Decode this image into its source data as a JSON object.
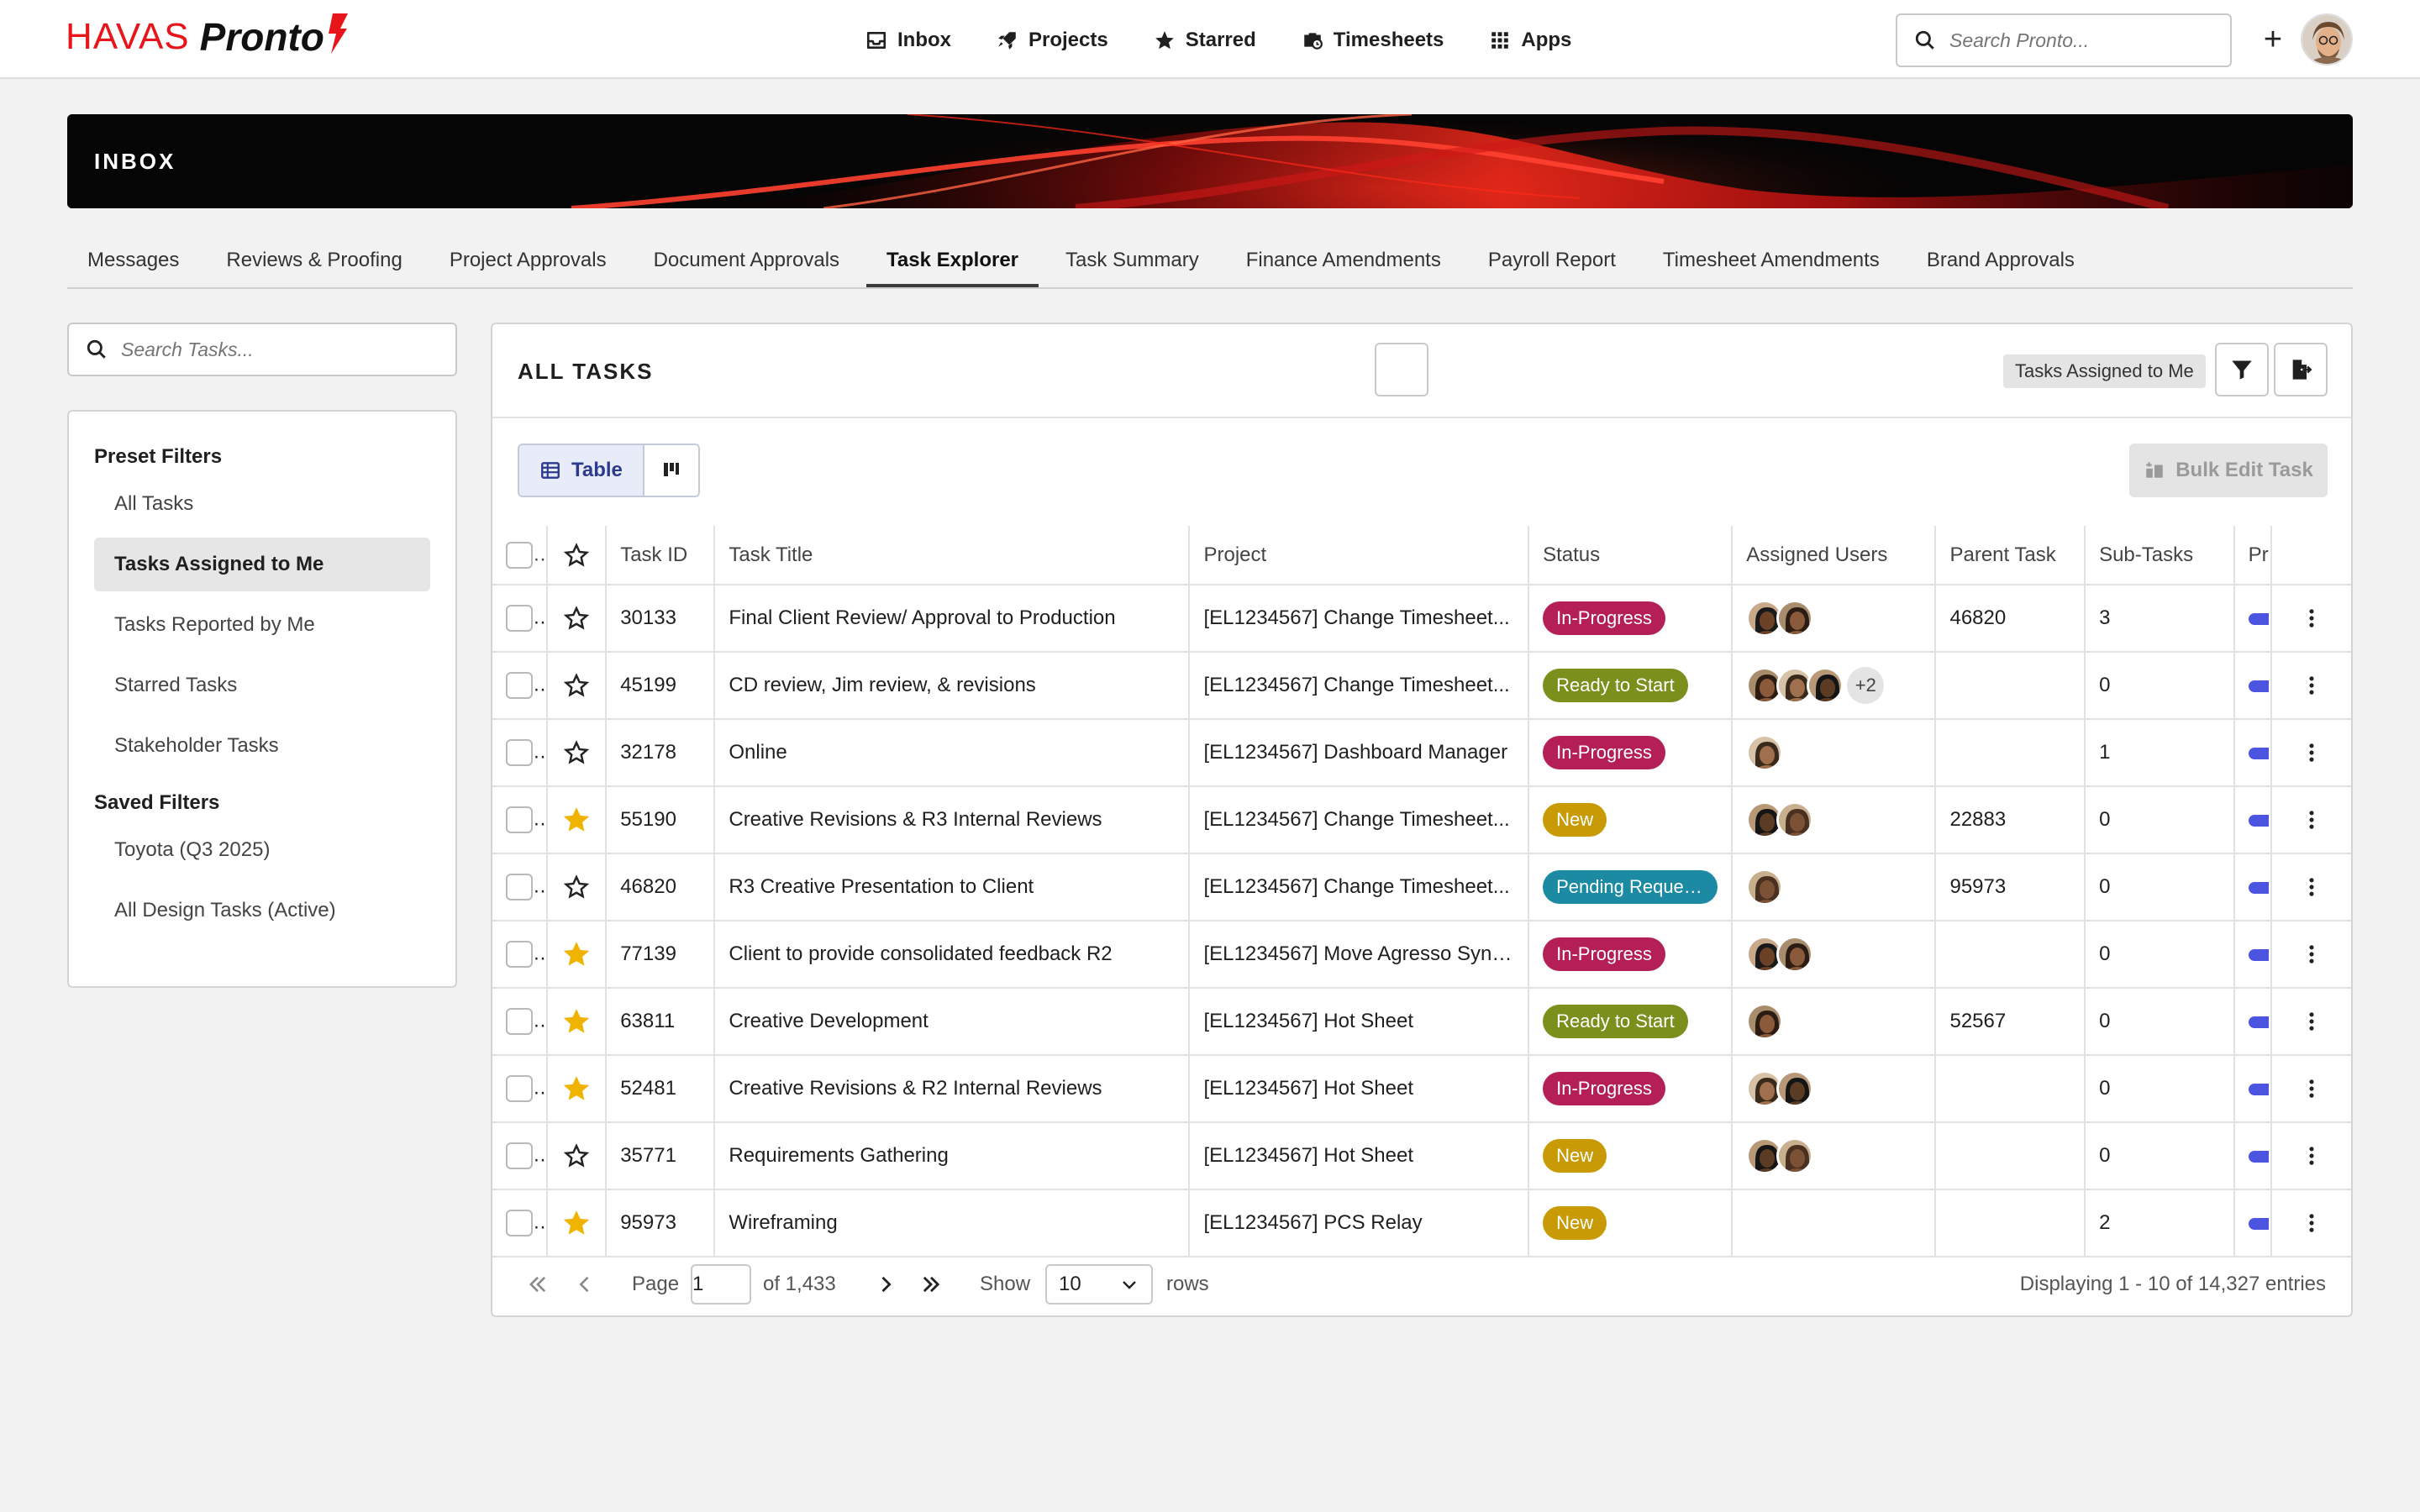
{
  "brand": {
    "havas": "HAVAS",
    "pronto": "Pronto"
  },
  "nav": [
    {
      "label": "Inbox",
      "icon": "inbox-icon"
    },
    {
      "label": "Projects",
      "icon": "rocket-icon"
    },
    {
      "label": "Starred",
      "icon": "star-icon"
    },
    {
      "label": "Timesheets",
      "icon": "briefcase-clock-icon"
    },
    {
      "label": "Apps",
      "icon": "grid-icon"
    }
  ],
  "search": {
    "placeholder": "Search Pronto..."
  },
  "banner": {
    "title": "INBOX"
  },
  "tabs": [
    "Messages",
    "Reviews & Proofing",
    "Project Approvals",
    "Document Approvals",
    "Task Explorer",
    "Task Summary",
    "Finance Amendments",
    "Payroll Report",
    "Timesheet Amendments",
    "Brand Approvals"
  ],
  "active_tab": "Task Explorer",
  "left": {
    "search_placeholder": "Search Tasks...",
    "preset_heading": "Preset Filters",
    "preset": [
      "All Tasks",
      "Tasks Assigned to Me",
      "Tasks Reported by Me",
      "Starred Tasks",
      "Stakeholder Tasks"
    ],
    "saved_heading": "Saved Filters",
    "saved": [
      "Toyota (Q3 2025)",
      "All Design Tasks (Active)"
    ]
  },
  "card": {
    "title": "ALL TASKS",
    "active_filter": "Tasks Assigned to Me",
    "view_table": "Table",
    "bulk_edit": "Bulk Edit Task"
  },
  "columns": [
    "Task ID",
    "Task Title",
    "Project",
    "Status",
    "Assigned Users",
    "Parent Task",
    "Sub-Tasks",
    "Pr"
  ],
  "status_colors": {
    "In-Progress": "#b51f57",
    "Ready to Start": "#7a8f1c",
    "New": "#c79a06",
    "Pending Reques...": "#1d8aa3"
  },
  "rows": [
    {
      "id": "30133",
      "title": "Final Client Review/ Approval to Production",
      "project": "[EL1234567] Change Timesheet...",
      "status": "In-Progress",
      "users": 2,
      "more": "",
      "parent": "46820",
      "subtasks": "3",
      "starred": false
    },
    {
      "id": "45199",
      "title": "CD review, Jim review, & revisions",
      "project": "[EL1234567] Change Timesheet...",
      "status": "Ready to Start",
      "users": 3,
      "more": "+2",
      "parent": "",
      "subtasks": "0",
      "starred": false
    },
    {
      "id": "32178",
      "title": "Online",
      "project": "[EL1234567] Dashboard Manager",
      "status": "In-Progress",
      "users": 1,
      "more": "",
      "parent": "",
      "subtasks": "1",
      "starred": false
    },
    {
      "id": "55190",
      "title": "Creative Revisions & R3 Internal Reviews",
      "project": "[EL1234567] Change Timesheet...",
      "status": "New",
      "users": 2,
      "more": "",
      "parent": "22883",
      "subtasks": "0",
      "starred": true
    },
    {
      "id": "46820",
      "title": "R3 Creative Presentation to Client",
      "project": "[EL1234567] Change Timesheet...",
      "status": "Pending Reques...",
      "users": 1,
      "more": "",
      "parent": "95973",
      "subtasks": "0",
      "starred": false
    },
    {
      "id": "77139",
      "title": "Client to provide consolidated feedback R2",
      "project": "[EL1234567] Move Agresso Sync...",
      "status": "In-Progress",
      "users": 2,
      "more": "",
      "parent": "",
      "subtasks": "0",
      "starred": true
    },
    {
      "id": "63811",
      "title": "Creative Development",
      "project": "[EL1234567] Hot Sheet",
      "status": "Ready to Start",
      "users": 1,
      "more": "",
      "parent": "52567",
      "subtasks": "0",
      "starred": true
    },
    {
      "id": "52481",
      "title": "Creative Revisions & R2 Internal Reviews",
      "project": "[EL1234567] Hot Sheet",
      "status": "In-Progress",
      "users": 2,
      "more": "",
      "parent": "",
      "subtasks": "0",
      "starred": true
    },
    {
      "id": "35771",
      "title": "Requirements Gathering",
      "project": "[EL1234567] Hot Sheet",
      "status": "New",
      "users": 2,
      "more": "",
      "parent": "",
      "subtasks": "0",
      "starred": false
    },
    {
      "id": "95973",
      "title": "Wireframing",
      "project": "[EL1234567] PCS Relay",
      "status": "New",
      "users": 0,
      "more": "",
      "parent": "",
      "subtasks": "2",
      "starred": true
    }
  ],
  "pager": {
    "page_label": "Page",
    "page": "1",
    "of": "of 1,433",
    "show": "Show",
    "rows_value": "10",
    "rows_label": "rows",
    "summary": "Displaying 1 - 10 of 14,327 entries"
  }
}
